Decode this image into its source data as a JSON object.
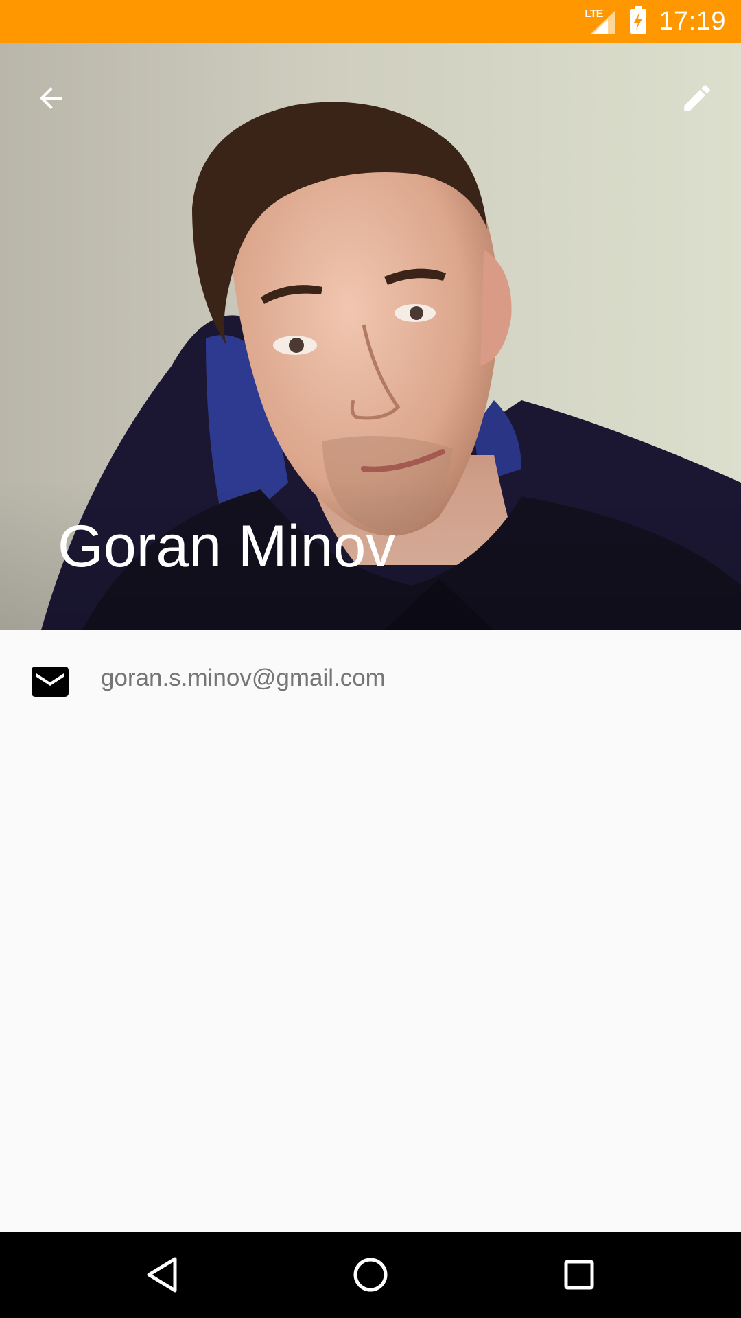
{
  "status_bar": {
    "network_label": "LTE",
    "time": "17:19",
    "background_color": "#ff9800",
    "icons": [
      "lte-signal-icon",
      "battery-charging-icon"
    ]
  },
  "toolbar": {
    "back_icon": "arrow-back-icon",
    "edit_icon": "pencil-edit-icon"
  },
  "contact": {
    "name": "Goran Minov",
    "photo": "contact-photo"
  },
  "details": {
    "email": {
      "icon": "mail-icon",
      "value": "goran.s.minov@gmail.com"
    }
  },
  "navigation_bar": {
    "icons": [
      "nav-back-icon",
      "nav-home-icon",
      "nav-recents-icon"
    ]
  }
}
